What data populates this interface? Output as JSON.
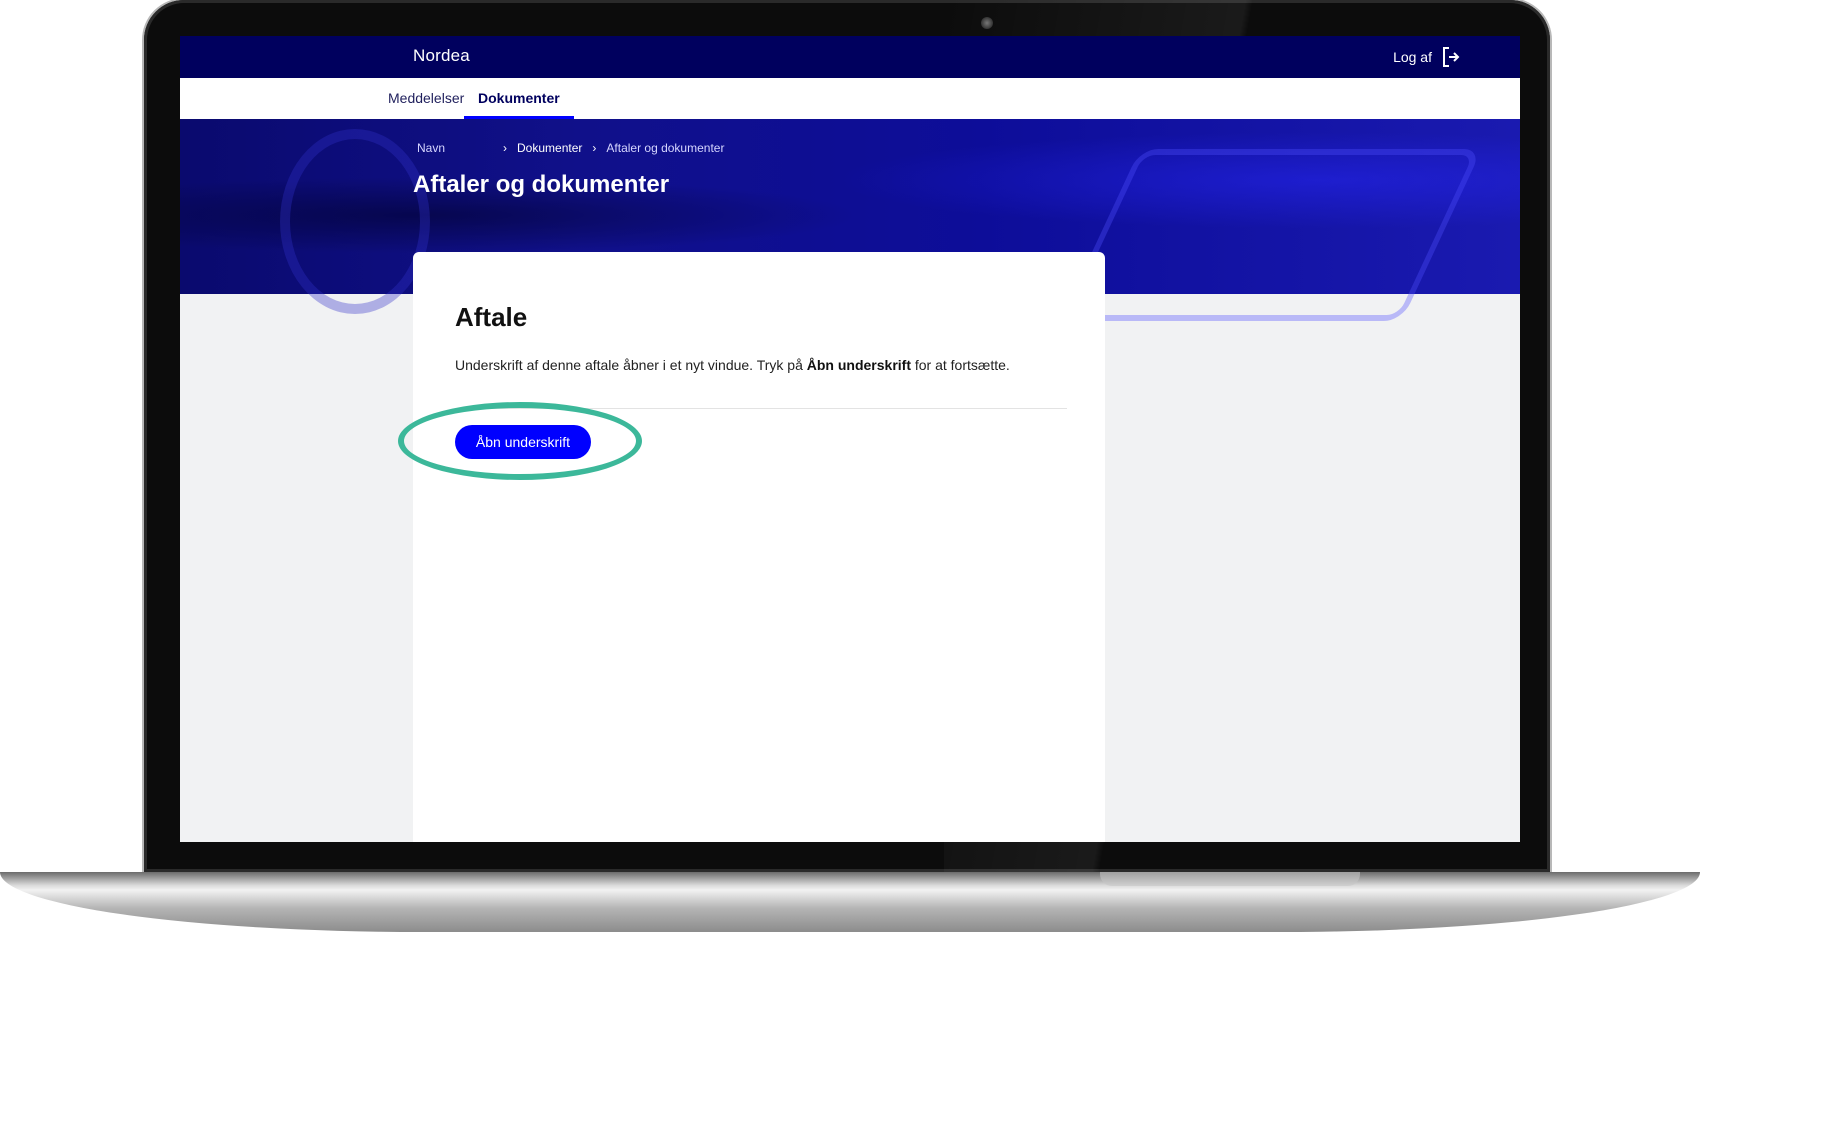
{
  "header": {
    "logo": "Nordea",
    "logout_label": "Log af"
  },
  "tabs": [
    {
      "label": "Meddelelser",
      "active": false
    },
    {
      "label": "Dokumenter",
      "active": true
    }
  ],
  "breadcrumb": {
    "items": [
      "Navn",
      "Dokumenter",
      "Aftaler og dokumenter"
    ]
  },
  "page": {
    "title": "Aftaler og dokumenter"
  },
  "card": {
    "title": "Aftale",
    "text_before": "Underskrift af denne aftale åbner i et nyt vindue. Tryk på ",
    "text_bold": "Åbn underskrift",
    "text_after": " for at fortsætte.",
    "button_label": "Åbn underskrift"
  },
  "colors": {
    "header_bg": "#00005e",
    "accent_blue": "#0000ff",
    "highlight_ring": "#3cb89a",
    "page_bg": "#f1f2f3"
  },
  "icons": {
    "logout": "logout-icon",
    "breadcrumb_separator": "chevron-right-icon"
  }
}
